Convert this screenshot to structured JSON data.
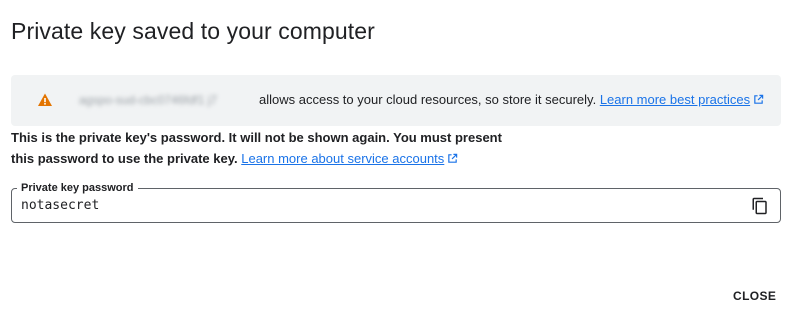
{
  "dialog": {
    "title": "Private key saved to your computer"
  },
  "warning": {
    "icon": "warning-icon",
    "icon_color": "#e37400",
    "redacted_key_id": "agspo-sud-cbc0746fdf1 j7",
    "message": "allows access to your cloud resources, so store it securely.",
    "link_label": "Learn more best practices"
  },
  "info": {
    "text": "This is the private key's password. It will not be shown again. You must present this password to use the private key.",
    "link_label": "Learn more about service accounts"
  },
  "password_field": {
    "label": "Private key password",
    "value": "notasecret",
    "copy_icon": "copy-icon"
  },
  "actions": {
    "close_label": "CLOSE"
  },
  "colors": {
    "link": "#1a73e8",
    "banner_bg": "#f1f3f4",
    "text": "#202124"
  }
}
